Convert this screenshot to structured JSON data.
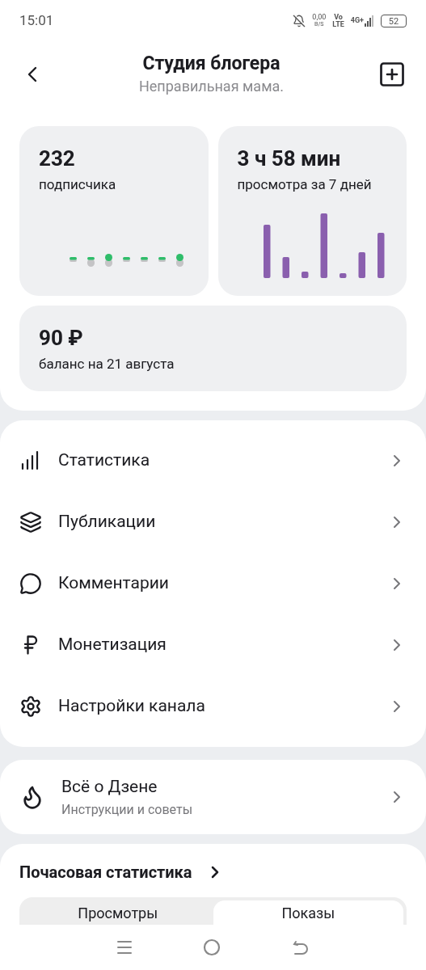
{
  "status_bar": {
    "time": "15:01",
    "speed": "0,00",
    "speed_unit": "B/S",
    "volte_top": "Vo",
    "volte_bottom": "LTE",
    "network": "4G+",
    "battery": "52"
  },
  "header": {
    "title": "Студия блогера",
    "subtitle": "Неправильная мама."
  },
  "stats": [
    {
      "value": "232",
      "label": "подписчика",
      "kind": "subscribers"
    },
    {
      "value": "3 ч 58 мин",
      "label": "просмотра за 7 дней",
      "kind": "views"
    },
    {
      "value": "90 ₽",
      "label": "баланс на 21 августа",
      "kind": "balance"
    }
  ],
  "menu": [
    {
      "label": "Статистика",
      "kind": "stats"
    },
    {
      "label": "Публикации",
      "kind": "publications"
    },
    {
      "label": "Комментарии",
      "kind": "comments"
    },
    {
      "label": "Монетизация",
      "kind": "money"
    },
    {
      "label": "Настройки канала",
      "kind": "settings"
    }
  ],
  "about": {
    "title": "Всё о Дзене",
    "subtitle": "Инструкции и советы"
  },
  "hourly": {
    "title": "Почасовая статистика",
    "tabs": [
      {
        "label": "Просмотры",
        "selected": false
      },
      {
        "label": "Показы",
        "selected": true
      }
    ]
  }
}
